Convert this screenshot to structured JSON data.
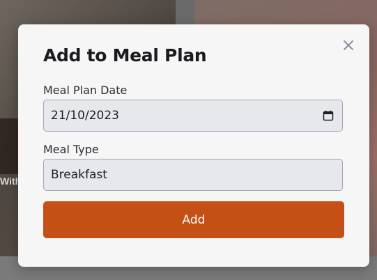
{
  "background": {
    "card_text": "With"
  },
  "modal": {
    "title": "Add to Meal Plan",
    "close_icon": "close-icon",
    "date_field": {
      "label": "Meal Plan Date",
      "value": "21/10/2023",
      "icon": "calendar-icon"
    },
    "type_field": {
      "label": "Meal Type",
      "value": "Breakfast"
    },
    "add_button_label": "Add"
  },
  "colors": {
    "accent": "#c55015",
    "modal_bg": "#f6f6f7",
    "input_bg": "#e7e8eb",
    "input_border": "#a4a7b0"
  }
}
